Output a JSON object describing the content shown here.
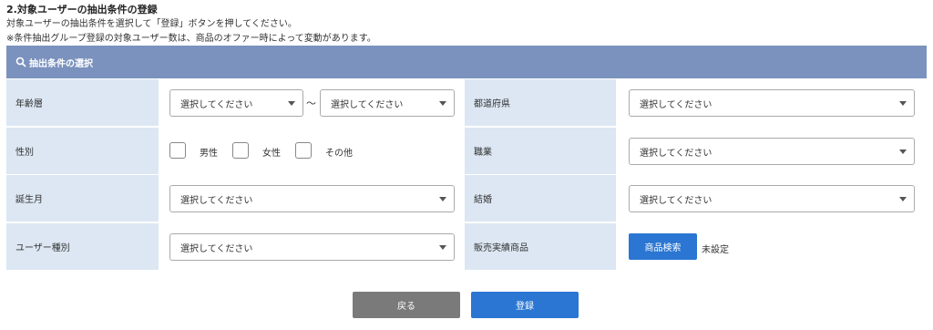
{
  "section": {
    "title": "2.対象ユーザーの抽出条件の登録",
    "desc_line1": "対象ユーザーの抽出条件を選択して「登録」ボタンを押してください。",
    "desc_line2": "※条件抽出グループ登録の対象ユーザー数は、商品のオファー時によって変動があります。"
  },
  "panel": {
    "header": "抽出条件の選択",
    "header_icon": "search-icon",
    "header_color": "#7a92bd",
    "label_bg": "#dce7f3"
  },
  "rows": {
    "age": {
      "label": "年齢層",
      "from": "選択してください",
      "tilde": "〜",
      "to": "選択してください"
    },
    "prefecture": {
      "label": "都道府県",
      "value": "選択してください"
    },
    "gender": {
      "label": "性別",
      "options": [
        "男性",
        "女性",
        "その他"
      ]
    },
    "occupation": {
      "label": "職業",
      "value": "選択してください"
    },
    "birth_month": {
      "label": "誕生月",
      "value": "選択してください"
    },
    "marriage": {
      "label": "結婚",
      "value": "選択してください"
    },
    "user_type": {
      "label": "ユーザー種別",
      "value": "選択してください"
    },
    "sales_product": {
      "label": "販売実績商品",
      "button": "商品検索",
      "status": "未設定"
    }
  },
  "footer": {
    "back_label": "戻る",
    "register_label": "登録",
    "primary_color": "#2a76d2",
    "secondary_color": "#7a7a7a"
  }
}
